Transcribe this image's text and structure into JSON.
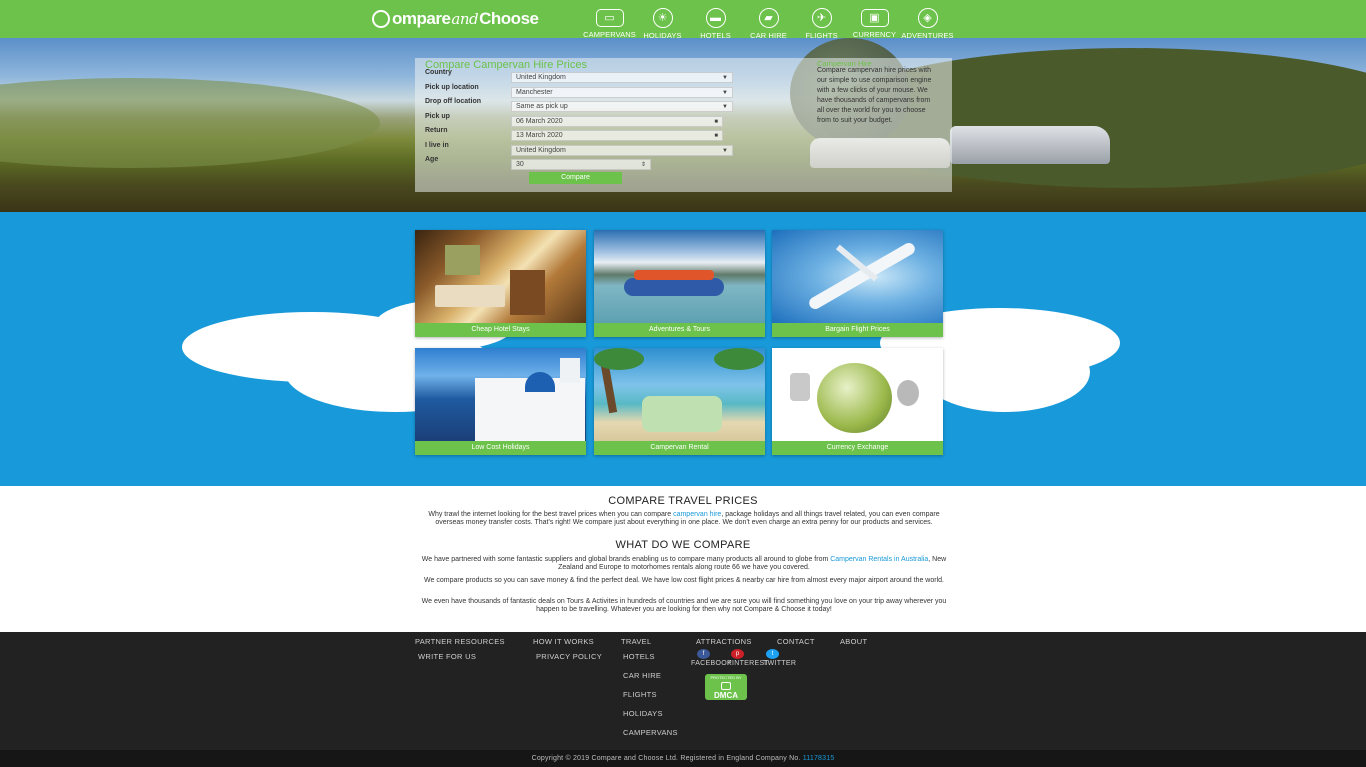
{
  "brand": {
    "name_part1": "ompare",
    "name_and": "and",
    "name_part2": "Choose"
  },
  "nav": [
    {
      "label": "CAMPERVANS",
      "icon": "campervan-icon",
      "glyph": "▭"
    },
    {
      "label": "HOLIDAYS",
      "icon": "sun-icon",
      "glyph": "☀"
    },
    {
      "label": "HOTELS",
      "icon": "bed-icon",
      "glyph": "▬"
    },
    {
      "label": "CAR HIRE",
      "icon": "car-icon",
      "glyph": "▰"
    },
    {
      "label": "FLIGHTS",
      "icon": "plane-icon",
      "glyph": "✈"
    },
    {
      "label": "CURRENCY",
      "icon": "banknote-icon",
      "glyph": "▣"
    },
    {
      "label": "ADVENTURES",
      "icon": "compass-icon",
      "glyph": "◈"
    }
  ],
  "search": {
    "title": "Compare Campervan Hire Prices",
    "fields": [
      {
        "label": "Country",
        "value": "United Kingdom",
        "kind": "select"
      },
      {
        "label": "Pick up location",
        "value": "Manchester",
        "kind": "select"
      },
      {
        "label": "Drop off location",
        "value": "Same as pick up",
        "kind": "select"
      },
      {
        "label": "Pick up",
        "value": "06 March 2020",
        "kind": "date"
      },
      {
        "label": "Return",
        "value": "13 March 2020",
        "kind": "date"
      },
      {
        "label": "I live in",
        "value": "United Kingdom",
        "kind": "select"
      },
      {
        "label": "Age",
        "value": "30",
        "kind": "number"
      }
    ],
    "button": "Compare",
    "promo_title": "Campervan Hire",
    "promo_text": "Compare campervan hire prices with our simple to use comparison engine with a few clicks of your mouse. We have thousands of campervans from all over the world for you to choose from to suit your budget."
  },
  "tiles": [
    {
      "caption": "Cheap Hotel Stays"
    },
    {
      "caption": "Adventures & Tours"
    },
    {
      "caption": "Bargain Flight Prices"
    },
    {
      "caption": "Low Cost Holidays"
    },
    {
      "caption": "Campervan Rental"
    },
    {
      "caption": "Currency Exchange"
    }
  ],
  "content": {
    "h1": "COMPARE TRAVEL PRICES",
    "p1_a": "Why trawl the internet looking for the best travel prices when you can compare ",
    "p1_link": "campervan hire",
    "p1_b": ", package holidays and all things travel related, you can even compare overseas money transfer costs. That's right! We compare just about everything in one place. We don't even charge an extra penny for our products and services.",
    "h2": "WHAT DO WE COMPARE",
    "p2_a": "We have partnered with some fantastic suppliers and global brands enabling us to compare many products all around to globe from ",
    "p2_link": "Campervan Rentals in Australia",
    "p2_b": ", New Zealand and Europe to motorhomes rentals along route 66 we have you covered.",
    "p3": "We compare products so you can save money & find the perfect deal. We have low cost flight prices & nearby car hire from almost every major airport around the world.",
    "p4": "We even have thousands of fantastic deals on Tours & Activites in hundreds of countries and we are sure you will find something you love on your trip away wherever you happen to be travelling. Whatever you are looking for then why not Compare & Choose it today!"
  },
  "footer": {
    "partner": "PARTNER RESOURCES",
    "write": "WRITE FOR US",
    "how": "HOW IT WORKS",
    "privacy": "PRIVACY POLICY",
    "travel": "TRAVEL",
    "travel_links": [
      "HOTELS",
      "CAR HIRE",
      "FLIGHTS",
      "HOLIDAYS",
      "CAMPERVANS"
    ],
    "attractions": "ATTRACTIONS",
    "facebook": "FACEBOOK",
    "pinterest": "PINTEREST",
    "twitter": "TWITTER",
    "contact": "CONTACT",
    "about": "ABOUT",
    "dmca_top": "PROTECTED BY",
    "dmca_big": "DMCA",
    "copyright": "Copyright © 2019 Compare and Choose Ltd. Registered in England Company No. ",
    "company_no": "11178315"
  },
  "colors": {
    "green": "#6cc24a",
    "blue": "#1899d9",
    "footer": "#222222"
  }
}
